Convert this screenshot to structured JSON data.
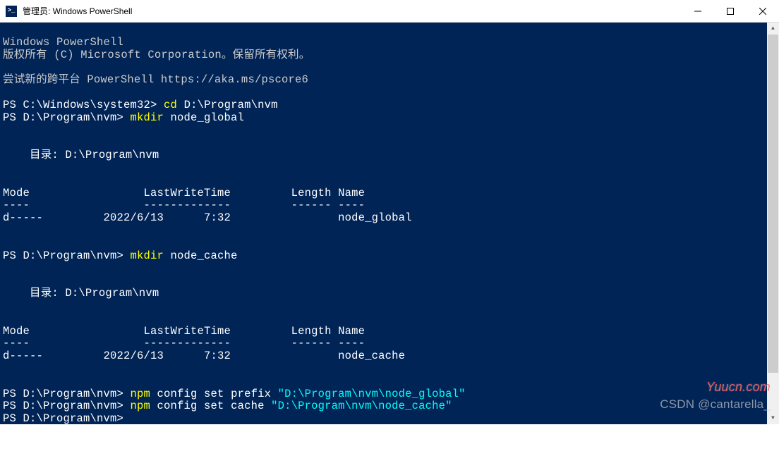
{
  "titlebar": {
    "title": "管理员: Windows PowerShell"
  },
  "terminal": {
    "header_line1": "Windows PowerShell",
    "header_line2": "版权所有 (C) Microsoft Corporation。保留所有权利。",
    "header_line3": "尝试新的跨平台 PowerShell https://aka.ms/pscore6",
    "prompt1": "PS C:\\Windows\\system32> ",
    "cmd1_a": "cd ",
    "cmd1_b": "D:\\Program\\nvm",
    "prompt2": "PS D:\\Program\\nvm> ",
    "cmd2_a": "mkdir ",
    "cmd2_b": "node_global",
    "dir_label1": "    目录: D:\\Program\\nvm",
    "table1_header": "Mode                 LastWriteTime         Length Name",
    "table1_divider": "----                 -------------         ------ ----",
    "table1_row": "d-----         2022/6/13      7:32                node_global",
    "prompt3": "PS D:\\Program\\nvm> ",
    "cmd3_a": "mkdir ",
    "cmd3_b": "node_cache",
    "dir_label2": "    目录: D:\\Program\\nvm",
    "table2_header": "Mode                 LastWriteTime         Length Name",
    "table2_divider": "----                 -------------         ------ ----",
    "table2_row": "d-----         2022/6/13      7:32                node_cache",
    "prompt4": "PS D:\\Program\\nvm> ",
    "cmd4_a": "npm ",
    "cmd4_b": "config set prefix ",
    "cmd4_c": "\"D:\\Program\\nvm\\node_global\"",
    "prompt5": "PS D:\\Program\\nvm> ",
    "cmd5_a": "npm ",
    "cmd5_b": "config set cache ",
    "cmd5_c": "\"D:\\Program\\nvm\\node_cache\"",
    "prompt6": "PS D:\\Program\\nvm> "
  },
  "watermarks": {
    "w1": "Yuucn.com",
    "w2": "CSDN @cantarella_"
  }
}
